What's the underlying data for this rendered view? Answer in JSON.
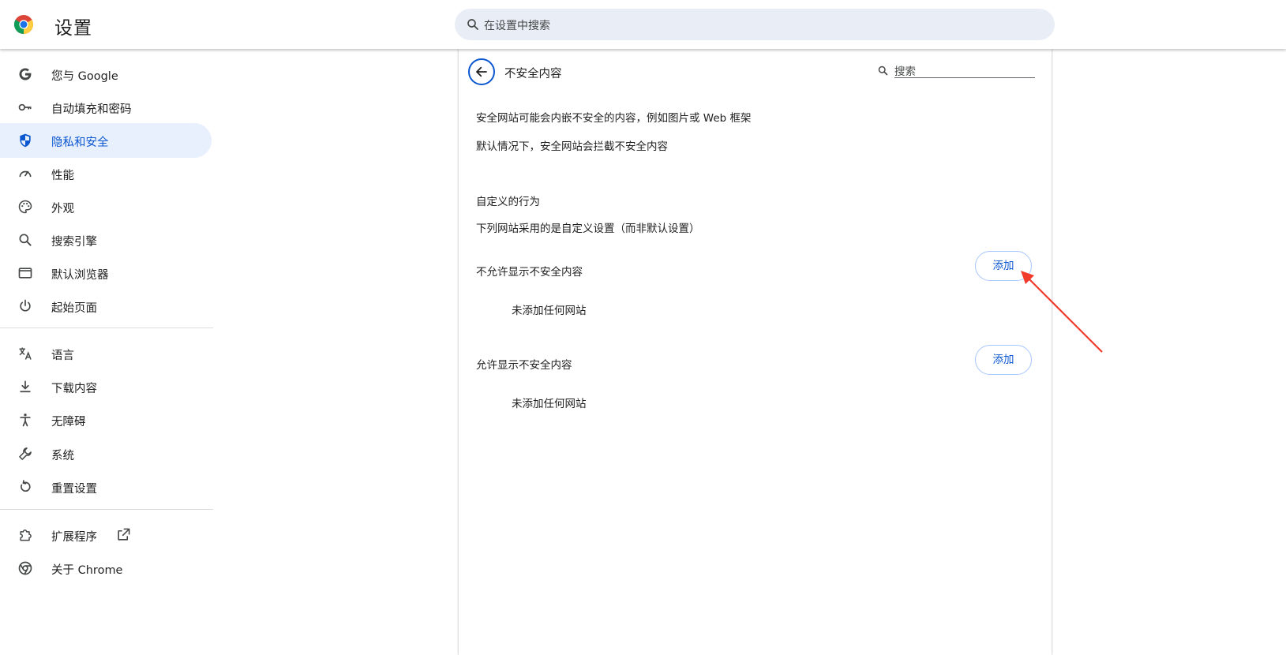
{
  "header": {
    "title": "设置",
    "search_placeholder": "在设置中搜索"
  },
  "sidebar": {
    "items": [
      {
        "label": "您与 Google",
        "icon": "google-g-icon"
      },
      {
        "label": "自动填充和密码",
        "icon": "key-icon"
      },
      {
        "label": "隐私和安全",
        "icon": "shield-icon",
        "active": true
      },
      {
        "label": "性能",
        "icon": "speedometer-icon"
      },
      {
        "label": "外观",
        "icon": "palette-icon"
      },
      {
        "label": "搜索引擎",
        "icon": "search-icon"
      },
      {
        "label": "默认浏览器",
        "icon": "browser-window-icon"
      },
      {
        "label": "起始页面",
        "icon": "power-icon"
      },
      {
        "label": "语言",
        "icon": "translate-icon"
      },
      {
        "label": "下载内容",
        "icon": "download-icon"
      },
      {
        "label": "无障碍",
        "icon": "accessibility-icon"
      },
      {
        "label": "系统",
        "icon": "wrench-icon"
      },
      {
        "label": "重置设置",
        "icon": "reset-icon"
      },
      {
        "label": "扩展程序",
        "icon": "puzzle-icon"
      },
      {
        "label": "关于 Chrome",
        "icon": "chrome-icon"
      }
    ]
  },
  "content": {
    "title": "不安全内容",
    "search_placeholder": "搜索",
    "description": "安全网站可能会内嵌不安全的内容，例如图片或 Web 框架",
    "default_behavior": "默认情况下，安全网站会拦截不安全内容",
    "custom_heading": "自定义的行为",
    "custom_desc": "下列网站采用的是自定义设置（而非默认设置）",
    "block_section": {
      "label": "不允许显示不安全内容",
      "add_label": "添加",
      "empty_text": "未添加任何网站"
    },
    "allow_section": {
      "label": "允许显示不安全内容",
      "add_label": "添加",
      "empty_text": "未添加任何网站"
    }
  },
  "colors": {
    "accent": "#0b57d0",
    "active_bg": "#e8f0fe",
    "search_bg": "#e9eef6",
    "annotation": "#f03a2c"
  }
}
